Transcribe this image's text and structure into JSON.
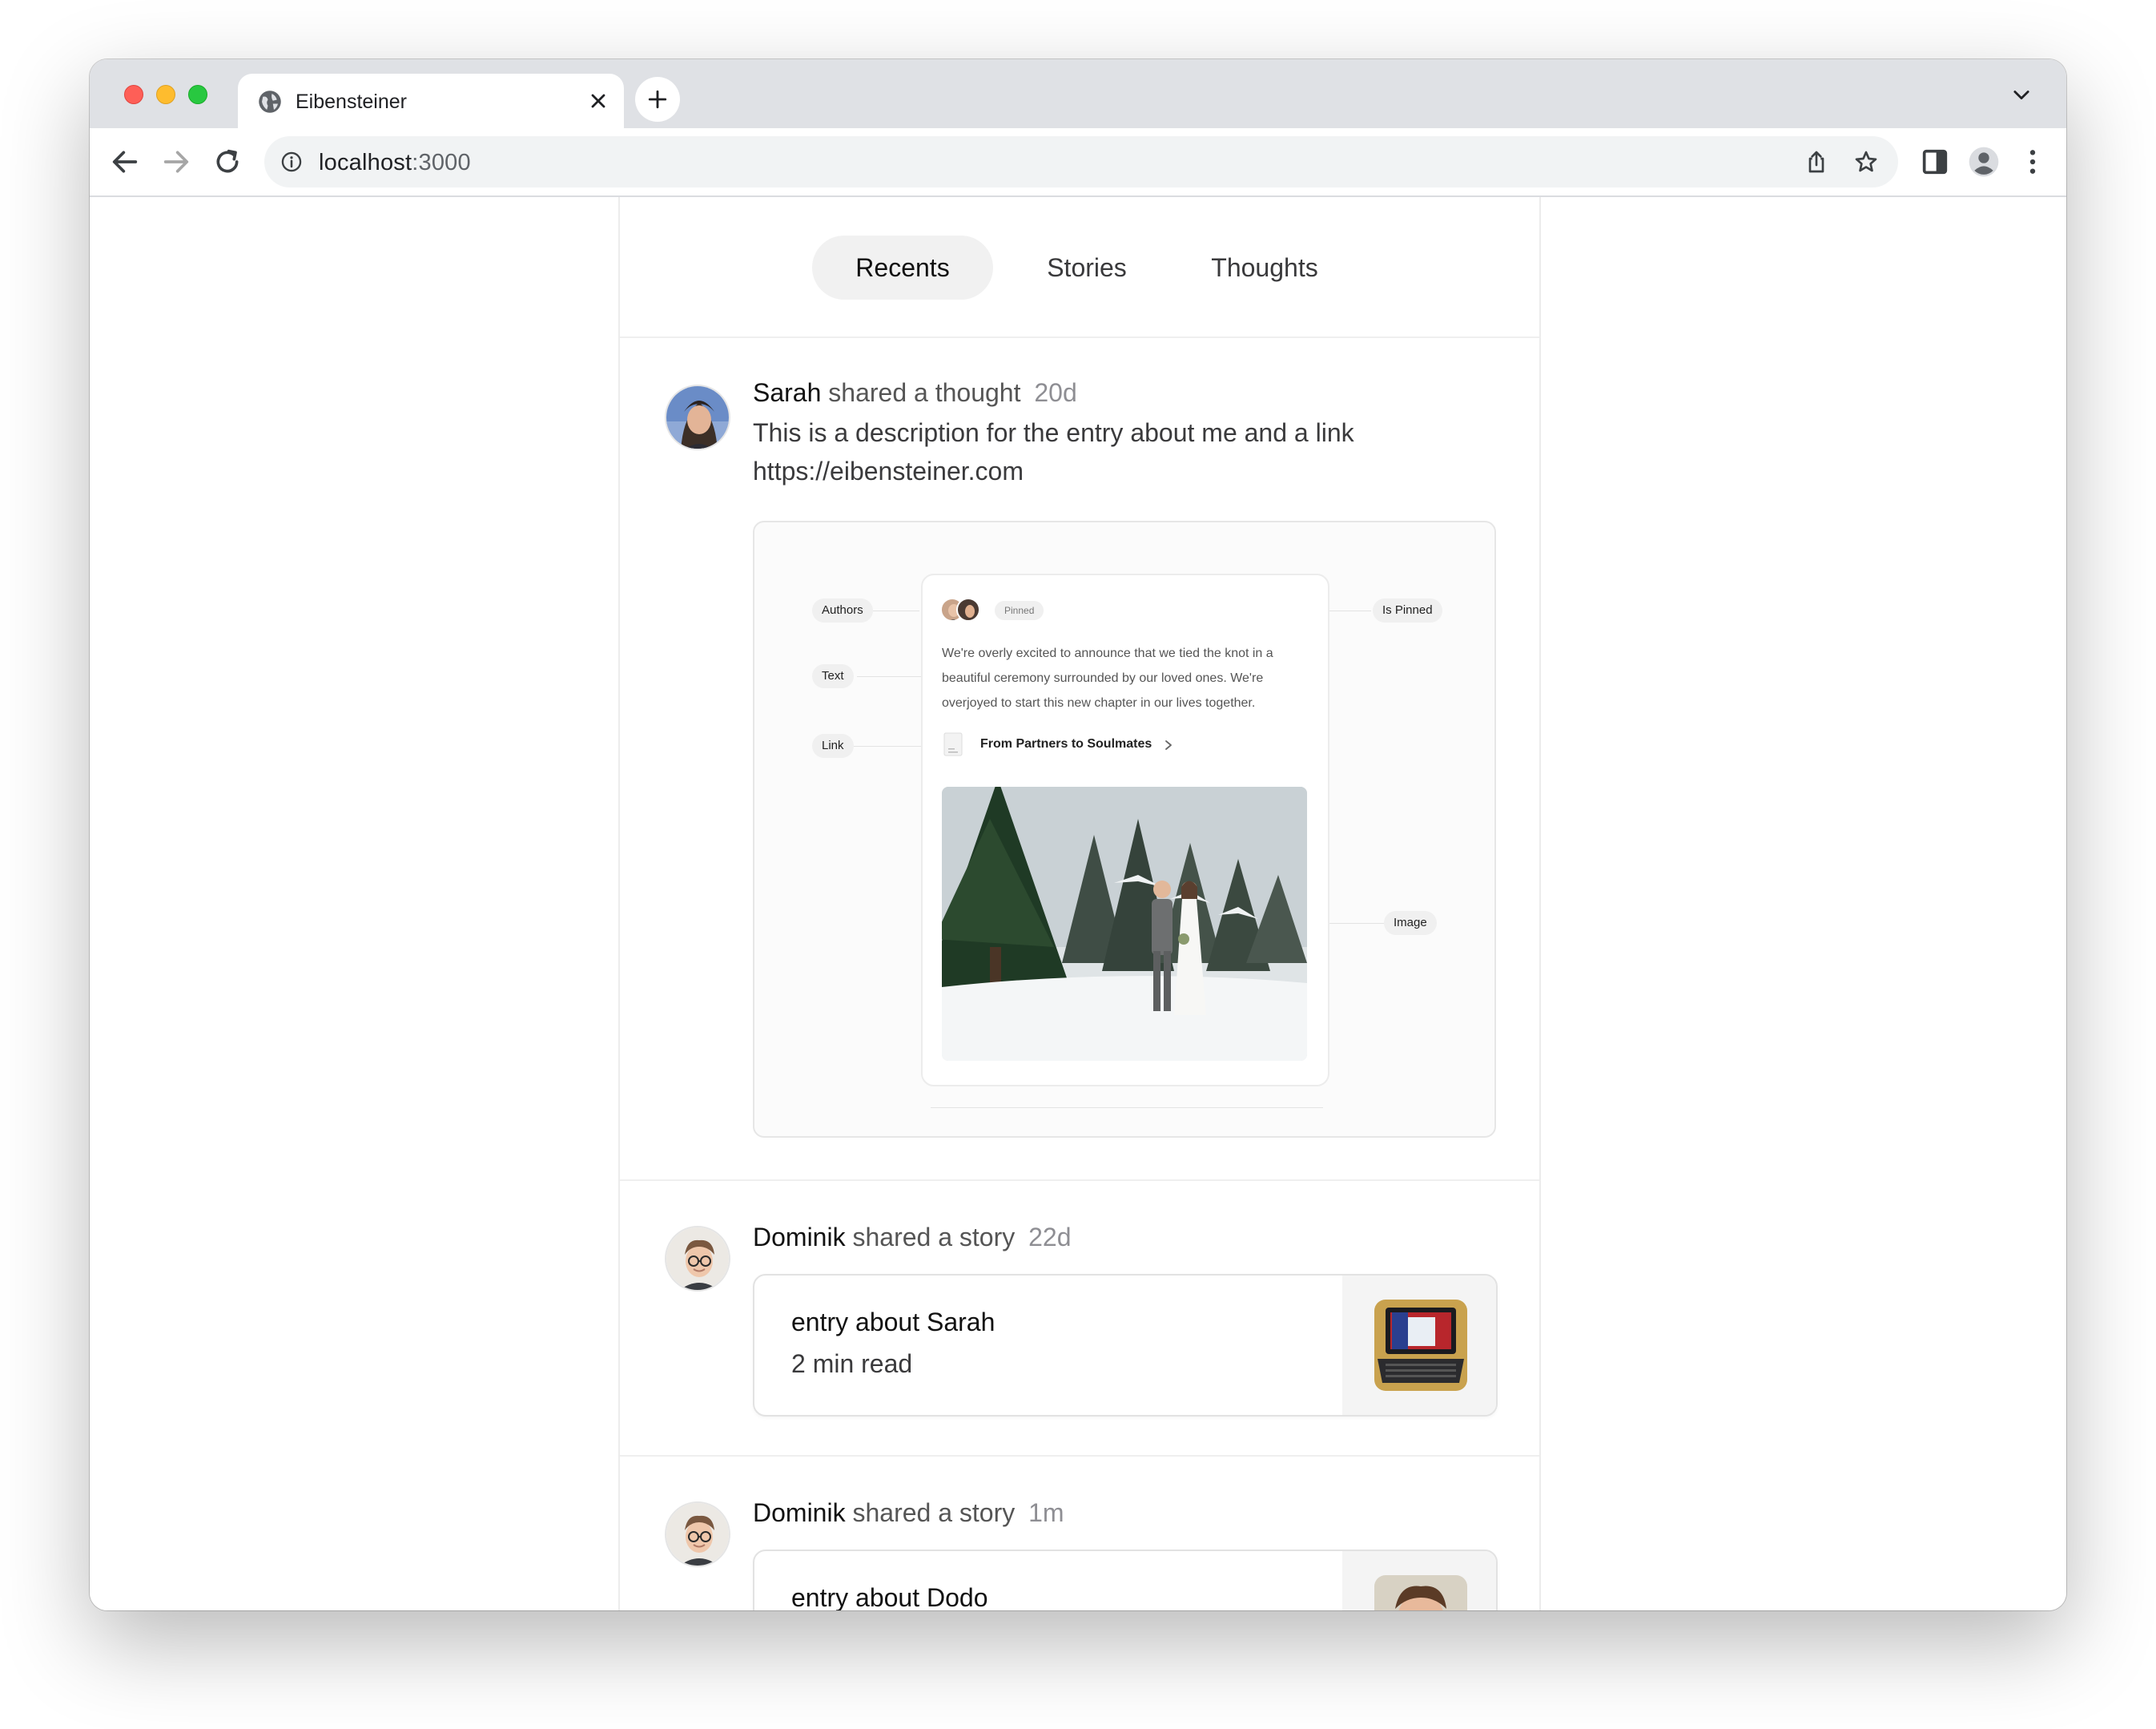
{
  "browser": {
    "tab_title": "Eibensteiner",
    "url_host": "localhost",
    "url_port": ":3000"
  },
  "feed_tabs": [
    {
      "label": "Recents",
      "active": true
    },
    {
      "label": "Stories",
      "active": false
    },
    {
      "label": "Thoughts",
      "active": false
    }
  ],
  "posts": [
    {
      "author": "Sarah",
      "action": "shared a thought",
      "time": "20d",
      "text_line1": "This is a description for the entry about me and a link",
      "text_line2": "https://eibensteiner.com",
      "embed": {
        "labels": {
          "authors": "Authors",
          "text": "Text",
          "link": "Link",
          "is_pinned": "Is Pinned",
          "image": "Image"
        },
        "pinned_badge": "Pinned",
        "text": "We're overly excited to announce that we tied the knot in a beautiful ceremony surrounded by our loved ones. We're overjoyed to start this new chapter in our lives together.",
        "link_title": "From Partners to Soulmates"
      }
    },
    {
      "author": "Dominik",
      "action": "shared a story",
      "time": "22d",
      "story_title": "entry about Sarah",
      "story_meta": "2 min read"
    },
    {
      "author": "Dominik",
      "action": "shared a story",
      "time": "1m",
      "story_title": "entry about Dodo"
    }
  ],
  "colors": {
    "active_tab_bg": "#f1f1f1",
    "muted_text": "#8e8e93",
    "border": "#ececec"
  }
}
